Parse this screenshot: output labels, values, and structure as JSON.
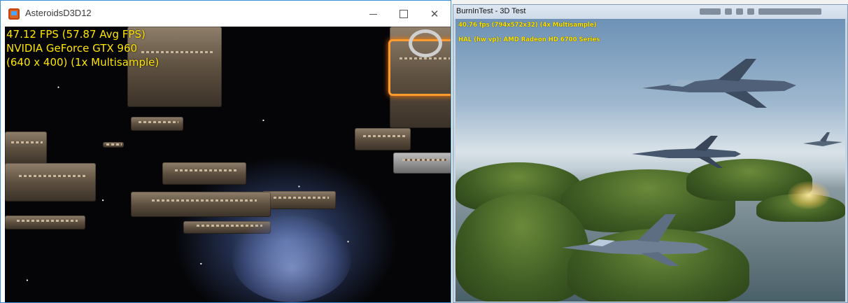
{
  "left_window": {
    "title": "AsteroidsD3D12",
    "icon": "app-icon",
    "controls": {
      "minimize": "—",
      "maximize": "☐",
      "close": "✕"
    },
    "stats": {
      "fps": "47.12 FPS (57.87 Avg FPS)",
      "gpu": "NVIDIA GeForce GTX 960",
      "resolution": "(640 x 400) (1x Multisample)"
    },
    "overlay_color": "#ffe600"
  },
  "right_window": {
    "title": "BurnInTest - 3D Test",
    "stats": {
      "fps": "40.76 fps (794x572x32) (4x Multisample)",
      "adapter": "HAL (hw vp): AMD Radeon HD 6700 Series"
    },
    "overlay_color": "#ffe600"
  }
}
